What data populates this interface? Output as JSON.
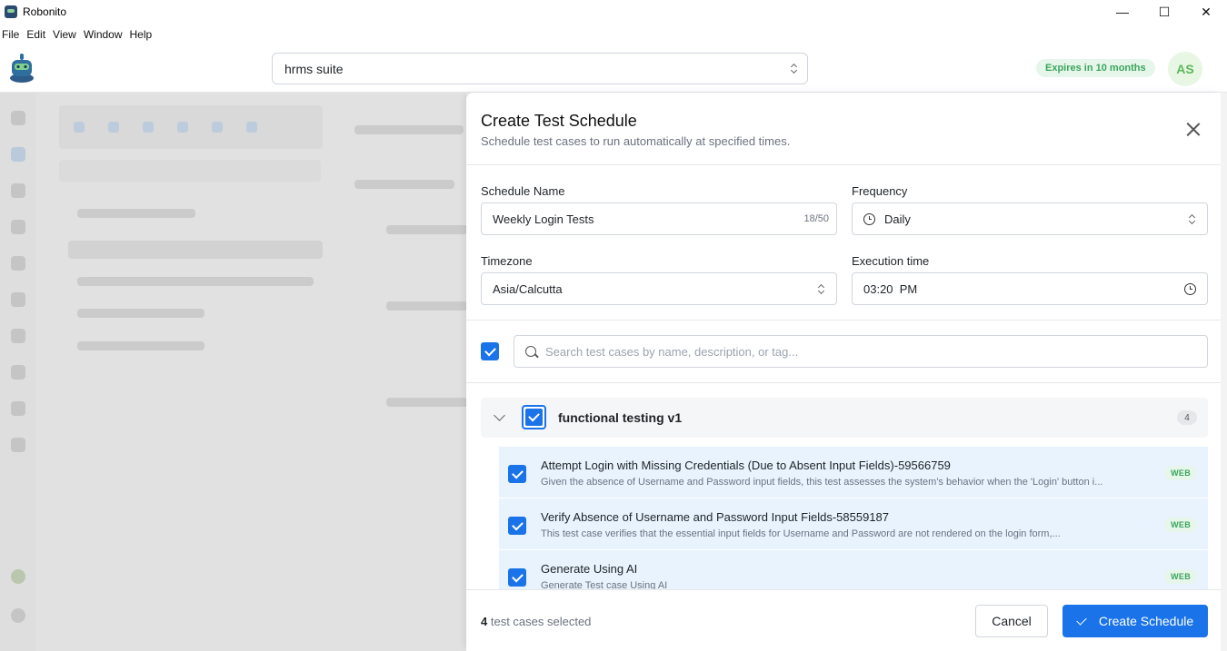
{
  "window": {
    "title": "Robonito",
    "controls": [
      "—",
      "☐",
      "✕"
    ]
  },
  "menu": [
    "File",
    "Edit",
    "View",
    "Window",
    "Help"
  ],
  "header": {
    "suite": "hrms suite",
    "expires": "Expires in 10 months",
    "avatar": "AS"
  },
  "drawer": {
    "title": "Create Test Schedule",
    "subtitle": "Schedule test cases to run automatically at specified times.",
    "schedule_name_label": "Schedule Name",
    "schedule_name_value": "Weekly Login Tests",
    "schedule_name_count": "18/50",
    "frequency_label": "Frequency",
    "frequency_value": "Daily",
    "timezone_label": "Timezone",
    "timezone_value": "Asia/Calcutta",
    "execution_time_label": "Execution time",
    "execution_time_value": "03:20  PM",
    "search_placeholder": "Search test cases by name, description, or tag...",
    "group": {
      "name": "functional testing v1",
      "count": "4"
    },
    "test_cases": [
      {
        "title": "Attempt Login with Missing Credentials (Due to Absent Input Fields)-59566759",
        "description": "Given the absence of Username and Password input fields, this test assesses the system's behavior when the 'Login' button i...",
        "badge": "WEB"
      },
      {
        "title": "Verify Absence of Username and Password Input Fields-58559187",
        "description": "This test case verifies that the essential input fields for Username and Password are not rendered on the login form,...",
        "badge": "WEB"
      },
      {
        "title": "Generate Using AI",
        "description": "Generate Test case Using AI",
        "badge": "WEB"
      }
    ],
    "footer": {
      "selected_count": "4",
      "selected_text": " test cases selected",
      "cancel": "Cancel",
      "create": "Create Schedule"
    }
  }
}
